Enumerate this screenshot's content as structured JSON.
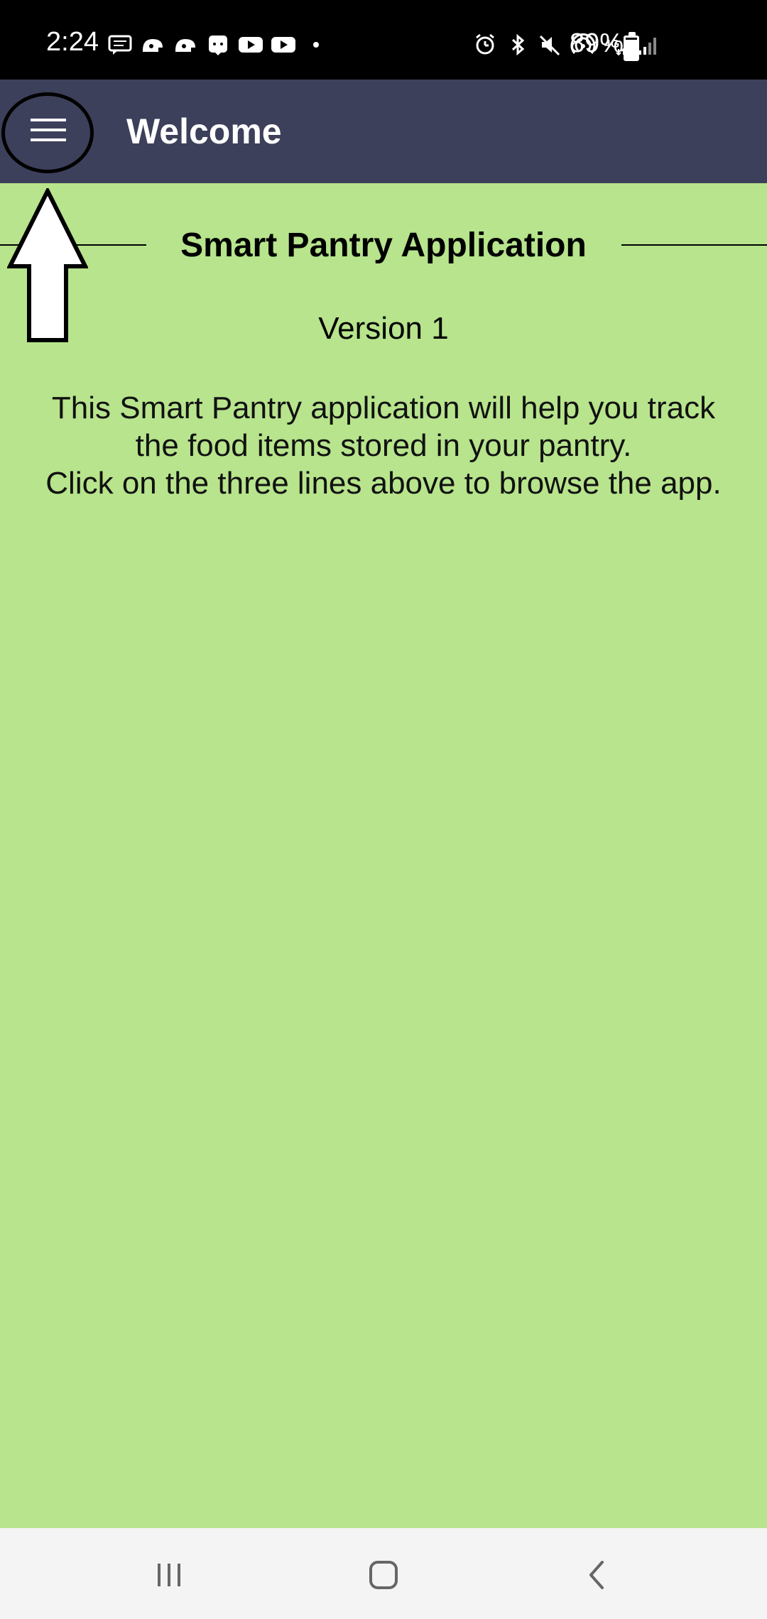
{
  "status_bar": {
    "time": "2:24",
    "battery_percent": "89%",
    "left_icons": [
      "message-icon",
      "app-icon",
      "app-icon",
      "app-icon",
      "youtube-icon",
      "youtube-icon",
      "dot-icon"
    ],
    "right_icons": [
      "alarm-icon",
      "bluetooth-icon",
      "mute-icon",
      "hotspot-icon",
      "network-4g-icon",
      "signal-icon",
      "battery-icon"
    ]
  },
  "app_bar": {
    "title": "Welcome",
    "menu_icon": "hamburger-menu-icon",
    "color": "#3d405a"
  },
  "content": {
    "heading": "Smart Pantry Application",
    "version": "Version 1",
    "description_line1": "This Smart Pantry application will help you track",
    "description_line2": "the food items stored in your pantry.",
    "description_line3": "Click on the three lines above to browse the app.",
    "background": "#b7e48c"
  },
  "nav_bar": {
    "buttons": [
      "recent-apps-icon",
      "home-icon",
      "back-icon"
    ]
  }
}
